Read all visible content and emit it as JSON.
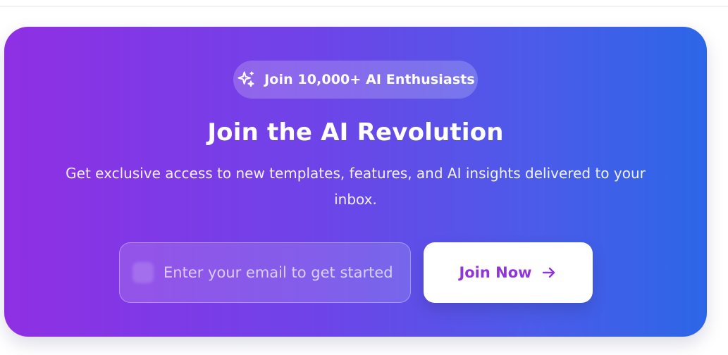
{
  "banner": {
    "badge_text": "Join 10,000+ AI Enthusiasts",
    "badge_icon": "sparkles-icon",
    "title": "Join the AI Revolution",
    "subtitle": "Get exclusive access to new templates, features, and AI insights delivered to your inbox."
  },
  "form": {
    "email_placeholder": "Enter your email to get started",
    "email_value": "",
    "email_icon": "mail-icon",
    "submit_label": "Join Now",
    "submit_icon": "arrow-right-icon"
  },
  "colors": {
    "gradient_start": "#8f2fe4",
    "gradient_end": "#2c66e8",
    "button_text": "#8e36d7",
    "button_bg": "#ffffff"
  }
}
